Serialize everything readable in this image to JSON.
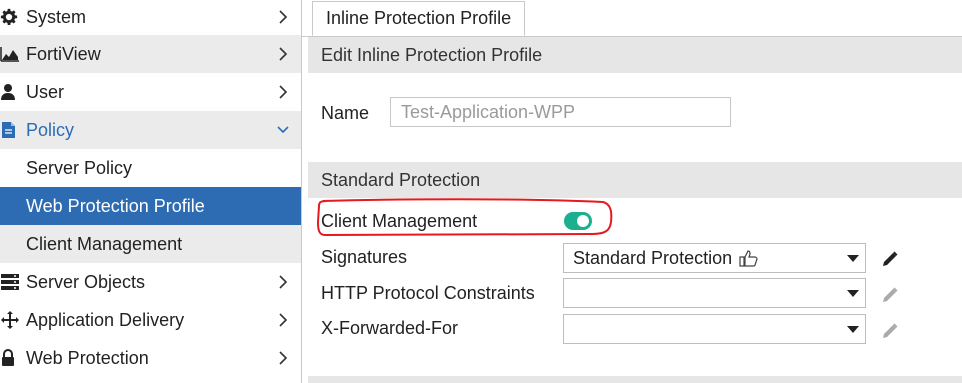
{
  "sidebar": {
    "items": [
      {
        "label": "System",
        "icon": "gear-icon"
      },
      {
        "label": "FortiView",
        "icon": "area-chart-icon"
      },
      {
        "label": "User",
        "icon": "user-icon"
      },
      {
        "label": "Policy",
        "icon": "policy-icon",
        "expanded": true
      },
      {
        "label": "Server Policy"
      },
      {
        "label": "Web Protection Profile",
        "selected": true
      },
      {
        "label": "Client Management"
      },
      {
        "label": "Server Objects",
        "icon": "server-icon"
      },
      {
        "label": "Application Delivery",
        "icon": "move-arrows-icon"
      },
      {
        "label": "Web Protection",
        "icon": "lock-icon"
      }
    ]
  },
  "tab": {
    "label": "Inline Protection Profile"
  },
  "edit_section": {
    "title": "Edit Inline Protection Profile"
  },
  "name_field": {
    "label": "Name",
    "placeholder": "Test-Application-WPP"
  },
  "standard_section": {
    "title": "Standard Protection"
  },
  "client_management": {
    "label": "Client Management",
    "enabled": true
  },
  "signatures": {
    "label": "Signatures",
    "value": "Standard Protection",
    "value_icon": "thumbs-up-icon"
  },
  "http_constraints": {
    "label": "HTTP Protocol Constraints",
    "value": ""
  },
  "x_forwarded_for": {
    "label": "X-Forwarded-For",
    "value": ""
  },
  "colors": {
    "accent": "#2d6cb3",
    "toggle_on": "#1aaf8e",
    "section_bg": "#e6e6e6",
    "annotation": "#e5191f"
  }
}
